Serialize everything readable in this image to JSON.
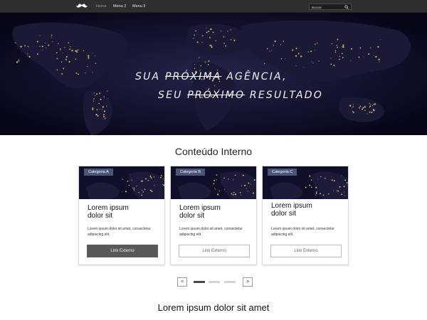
{
  "nav": {
    "items": [
      {
        "label": "Home"
      },
      {
        "label": "Menu 2"
      },
      {
        "label": "Menu 3"
      }
    ],
    "search_placeholder": "Buscar"
  },
  "hero": {
    "line1": {
      "before": "SUA ",
      "strike": "PRÓXIMA",
      "after": " AGÊNCIA,"
    },
    "line2": {
      "before": "SEU ",
      "strike": "PRÓXIMO",
      "after": " RESULTADO"
    }
  },
  "section_title": "Conteúdo Interno",
  "cards": [
    {
      "category": "Categoria A",
      "title_line1": "Lorem ipsum",
      "title_line2": "dolor sit",
      "text": "Lorem ipsum dolor sit amet, consectetur adipiscing elit.",
      "button": "Link Externo"
    },
    {
      "category": "Categoria B",
      "title_line1": "Lorem ipsum",
      "title_line2": "dolor sit",
      "text": "Lorem ipsum dolor sit amet, consectetur adipiscing elit.",
      "button": "Link Externo"
    },
    {
      "category": "Categoria C",
      "title_line1": "Lorem ipsum",
      "title_line2": "dolor sit",
      "text": "Lorem ipsum dolor sit amet, consectetur adipiscing elit.",
      "button": "Link Externo"
    }
  ],
  "carousel": {
    "prev": "<",
    "next": ">",
    "active_index": 0
  },
  "bottom_title": "Lorem ipsum dolor sit amet",
  "colors": {
    "navbar": "#2f2f2f",
    "hero_bg": "#0b0b1c",
    "badge": "#4a5675",
    "active_button": "#595959",
    "city_lights": "#f3d27a"
  },
  "icons": {
    "logo": "mustache-icon",
    "search": "search-icon"
  }
}
